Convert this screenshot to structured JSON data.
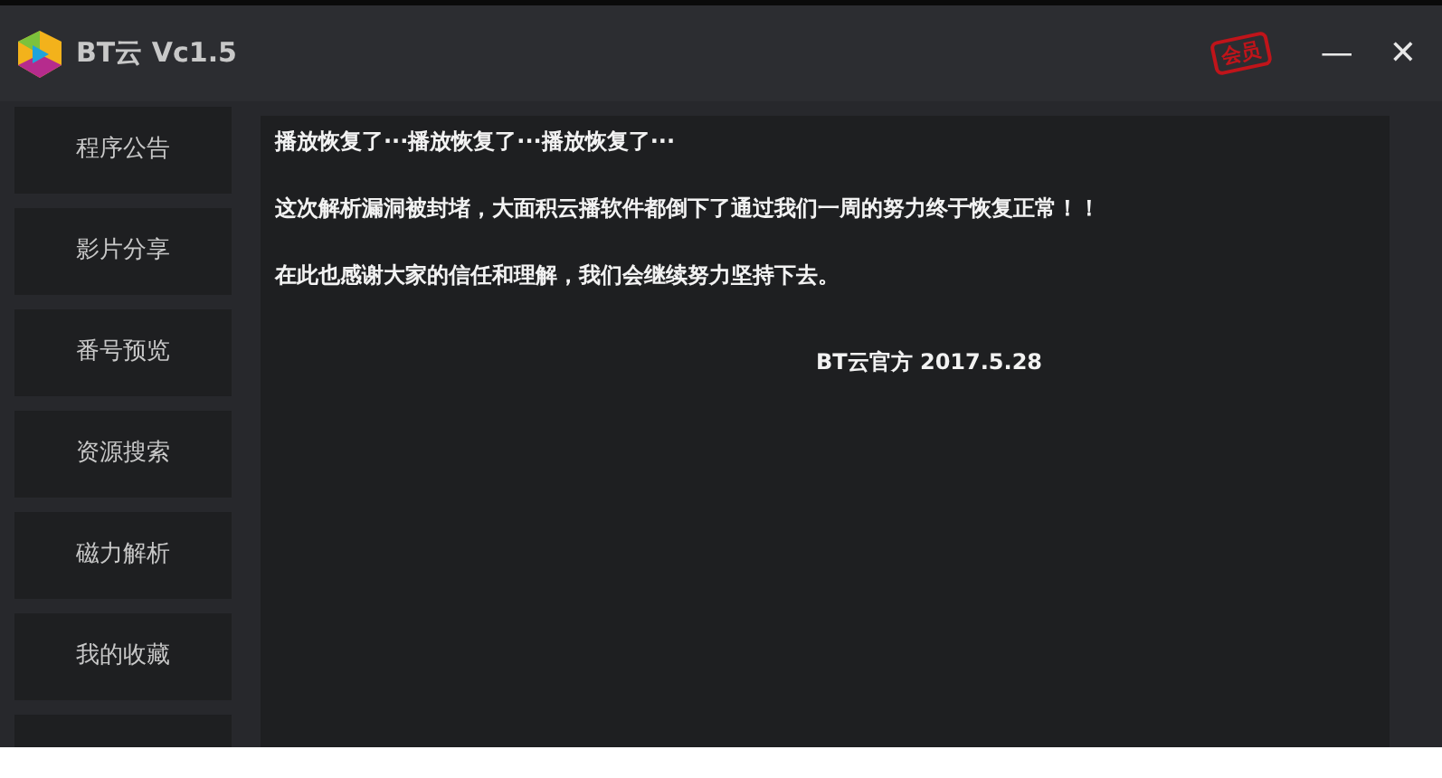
{
  "window": {
    "title": "BT云 Vc1.5",
    "member_stamp": "会员",
    "minimize": "—",
    "close": "✕"
  },
  "sidebar": {
    "items": [
      "程序公告",
      "影片分享",
      "番号预览",
      "资源搜索",
      "磁力解析",
      "我的收藏"
    ]
  },
  "announcement": {
    "paragraphs": [
      "播放恢复了···播放恢复了···播放恢复了···",
      "这次解析漏洞被封堵，大面积云播软件都倒下了通过我们一周的努力终于恢复正常！！",
      "在此也感谢大家的信任和理解，我们会继续努力坚持下去。"
    ],
    "signature": "BT云官方 2017.5.28"
  }
}
